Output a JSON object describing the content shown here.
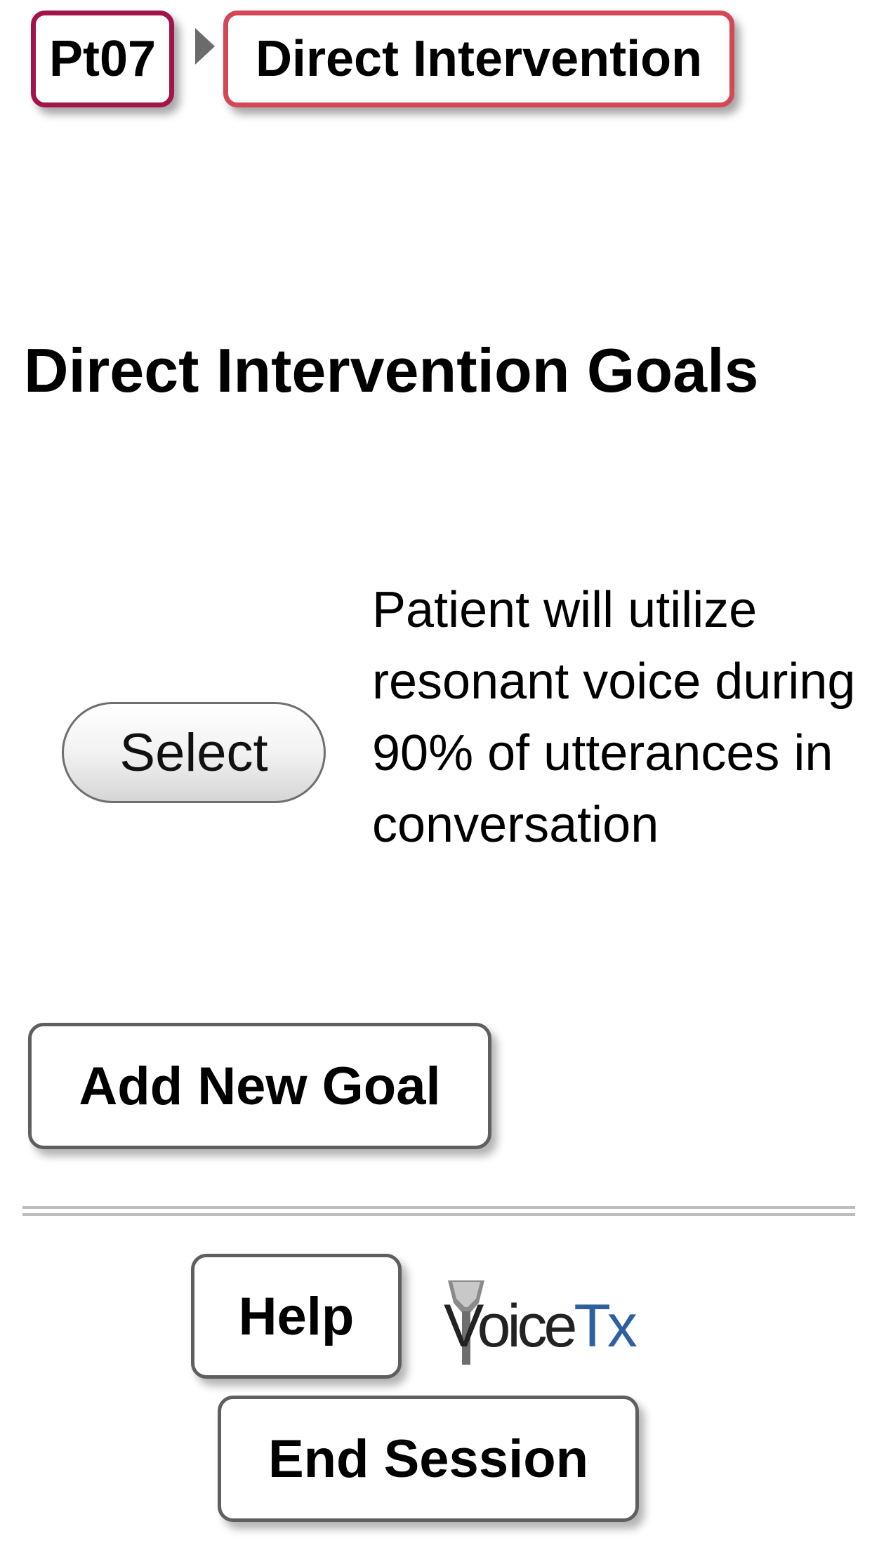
{
  "breadcrumb": {
    "patient": "Pt07",
    "section": "Direct Intervention"
  },
  "page_title": "Direct Intervention Goals",
  "goals": [
    {
      "select_label": "Select",
      "text": "Patient will utilize resonant voice during 90% of utterances in conversation"
    }
  ],
  "actions": {
    "add_goal_label": "Add New Goal",
    "help_label": "Help",
    "end_session_label": "End Session"
  },
  "logo": {
    "part1": "Voice",
    "part2": "Tx"
  },
  "colors": {
    "patient_crumb_border": "#a3154a",
    "section_crumb_border": "#d44756",
    "logo_accent": "#2e5f9e"
  }
}
